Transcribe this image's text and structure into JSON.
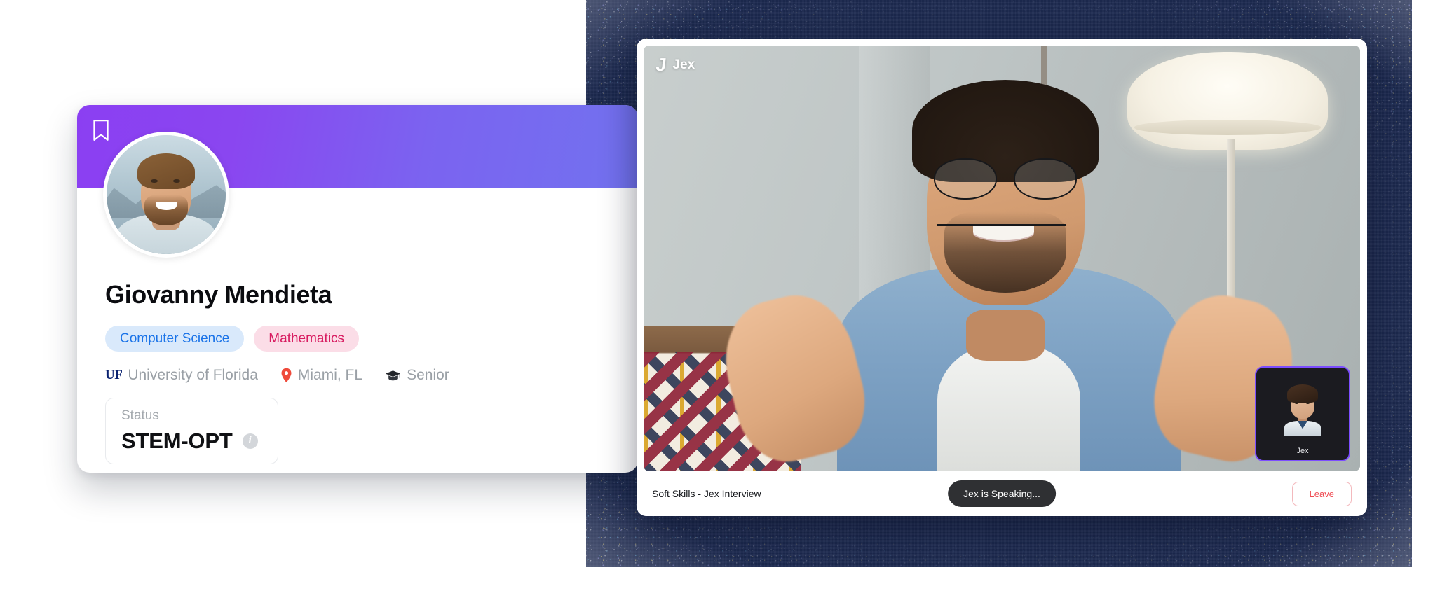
{
  "profile_card": {
    "bookmark_icon": "bookmark-icon",
    "avatar": "student-avatar",
    "name": "Giovanny Mendieta",
    "tags": [
      {
        "label": "Computer Science",
        "color": "#1a73e8",
        "background": "#d9e9fb"
      },
      {
        "label": "Mathematics",
        "color": "#d81b60",
        "background": "#fbdde7"
      }
    ],
    "meta": {
      "university_logo": "UF",
      "university": "University of Florida",
      "location_icon": "location-pin-icon",
      "location": "Miami, FL",
      "year_icon": "graduation-cap-icon",
      "year": "Senior"
    },
    "status": {
      "label": "Status",
      "value": "STEM-OPT",
      "info_icon": "info-icon"
    },
    "banner_gradient_from": "#8b3ff2",
    "banner_gradient_to": "#7272ef"
  },
  "call_window": {
    "watermark": {
      "mark": "J",
      "word": "Jex"
    },
    "pip": {
      "label": "Jex",
      "border_color": "#7c4dff"
    },
    "footer": {
      "session_title": "Soft Skills - Jex Interview",
      "speaking_status": "Jex is Speaking...",
      "leave_label": "Leave",
      "leave_color": "#ef4a52",
      "pill_background": "#2f3033"
    }
  },
  "theme": {
    "backdrop_color": "#1d2a50",
    "page_background": "#ffffff"
  }
}
